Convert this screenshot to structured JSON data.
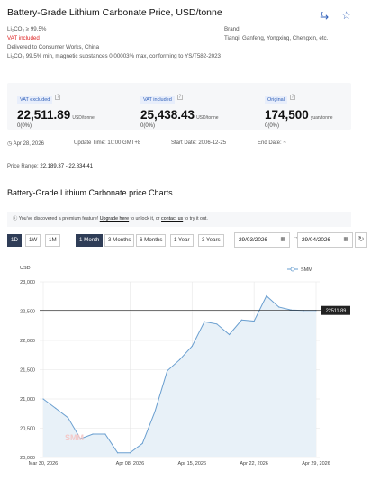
{
  "header": {
    "title": "Battery-Grade Lithium Carbonate Price, USD/tonne",
    "exchange_icon": "exchange-arrows-icon",
    "star_icon": "star-outline-icon"
  },
  "spec": {
    "purity": "Li₂CO₃ ≥ 99.5%",
    "vat": "VAT included",
    "delivery": "Delivered to Consumer Works, China",
    "desc": "Li₂CO₃ 99.5% min, magnetic substances 0.00003% max, conforming to YS/T582-2023",
    "brand_label": "Brand:",
    "brand_value": "Tianqi, Ganfeng, Yongxing, Chengxin, etc."
  },
  "prices": [
    {
      "tag": "VAT excluded",
      "value": "22,511.89",
      "unit": "USD/tonne",
      "change": "0(0%)"
    },
    {
      "tag": "VAT included",
      "value": "25,438.43",
      "unit": "USD/tonne",
      "change": "0(0%)"
    },
    {
      "tag": "Original",
      "value": "174,500",
      "unit": "yuan/tonne",
      "change": "0(0%)"
    }
  ],
  "meta": {
    "date": "Apr 28, 2026",
    "update": "Update Time: 10:00 GMT+8",
    "start": "Start Date: 2006-12-25",
    "end": "End Date: ~"
  },
  "price_range": {
    "label": "Price Range:",
    "value": "22,189.37 - 22,834.41"
  },
  "charts_title": "Battery-Grade Lithium Carbonate price Charts",
  "notice": {
    "text1": "You've discovered a premium feature! ",
    "link1": "Upgrade here",
    "text2": " to unlock it, or ",
    "link2": "contact us",
    "text3": " to try it out."
  },
  "timeframes": [
    "1D",
    "1W",
    "1M"
  ],
  "ranges": [
    "1 Month",
    "3 Months",
    "6 Months",
    "1 Year",
    "3 Years"
  ],
  "date_from": "29/03/2026",
  "date_to": "29/04/2026",
  "colors": {
    "accent": "#2f5fb8",
    "line": "#6a9fd0",
    "fill": "#e8f1f8",
    "active": "#2f3d57"
  },
  "chart_data": {
    "type": "area",
    "ylabel": "USD",
    "legend": "SMM",
    "legend_position": "top-right",
    "ylim": [
      20000,
      23000
    ],
    "yticks": [
      "23,000",
      "22,500",
      "22,000",
      "21,500",
      "21,000",
      "20,500",
      "20,000"
    ],
    "xticks": [
      "Mar 30, 2026",
      "Apr 08, 2026",
      "Apr 15, 2026",
      "Apr 22, 2026",
      "Apr 29, 2026"
    ],
    "x": [
      "Mar 30",
      "Mar 31",
      "Apr 01",
      "Apr 02",
      "Apr 03",
      "Apr 06",
      "Apr 07",
      "Apr 08",
      "Apr 09",
      "Apr 10",
      "Apr 13",
      "Apr 14",
      "Apr 15",
      "Apr 16",
      "Apr 17",
      "Apr 20",
      "Apr 21",
      "Apr 22",
      "Apr 23",
      "Apr 24",
      "Apr 27",
      "Apr 28",
      "Apr 29"
    ],
    "values": [
      21000,
      20840,
      20680,
      20320,
      20400,
      20400,
      20080,
      20080,
      20240,
      20780,
      21480,
      21670,
      21900,
      22320,
      22280,
      22100,
      22350,
      22330,
      22760,
      22570,
      22520,
      22512,
      22512
    ],
    "last_value_label": "22511.89",
    "watermark": "SMM"
  }
}
